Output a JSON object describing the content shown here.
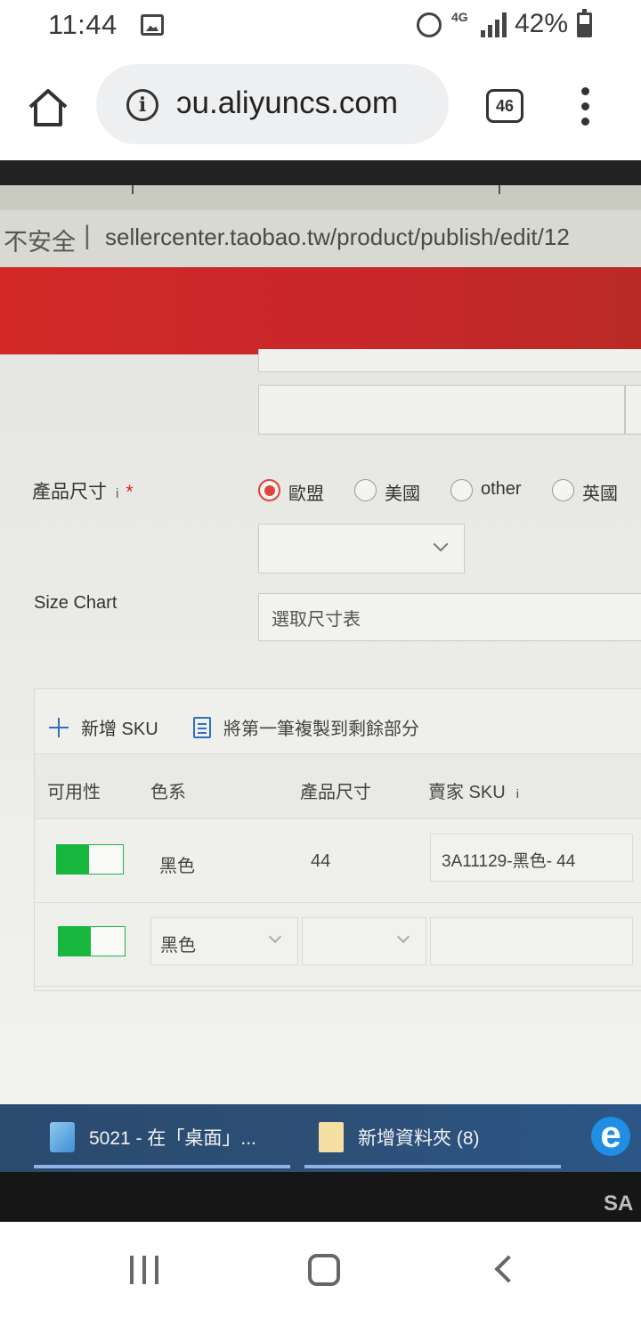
{
  "status_bar": {
    "time": "11:44",
    "network": "4G",
    "battery": "42%"
  },
  "browser": {
    "url": "ɔu.aliyuncs.com",
    "tab_count": "46"
  },
  "monitor": {
    "address_bar": {
      "insecure_label": "不安全",
      "separator": "|",
      "url": "sellercenter.taobao.tw/product/publish/edit/12"
    },
    "form": {
      "size_label": "產品尺寸",
      "info_mark": "i",
      "required_mark": "*",
      "size_options": [
        {
          "label": "歐盟",
          "selected": true
        },
        {
          "label": "美國",
          "selected": false
        },
        {
          "label": "other",
          "selected": false
        },
        {
          "label": "英國",
          "selected": false
        }
      ],
      "size_chart_label": "Size Chart",
      "size_chart_placeholder": "選取尺寸表"
    },
    "sku_panel": {
      "add_sku_label": "新增 SKU",
      "copy_label": "將第一筆複製到剩餘部分",
      "columns": [
        "可用性",
        "色系",
        "產品尺寸",
        "賣家 SKU"
      ],
      "seller_sku_info": "i",
      "rows": [
        {
          "available": true,
          "color": "黑色",
          "size": "44",
          "seller_sku": "3A11129-黑色- 44"
        },
        {
          "available": true,
          "color": "黑色",
          "size": "",
          "seller_sku": ""
        }
      ]
    },
    "taskbar": {
      "items": [
        {
          "label": "5021 - 在「桌面」..."
        },
        {
          "label": "新增資料夾 (8)"
        }
      ],
      "edge_glyph": "e"
    },
    "bezel_brand": "SA"
  },
  "colors": {
    "accent_red": "#d22828",
    "toggle_green": "#17b63c",
    "link_blue": "#2e6fc4",
    "taskbar_blue": "#2d4f76"
  }
}
